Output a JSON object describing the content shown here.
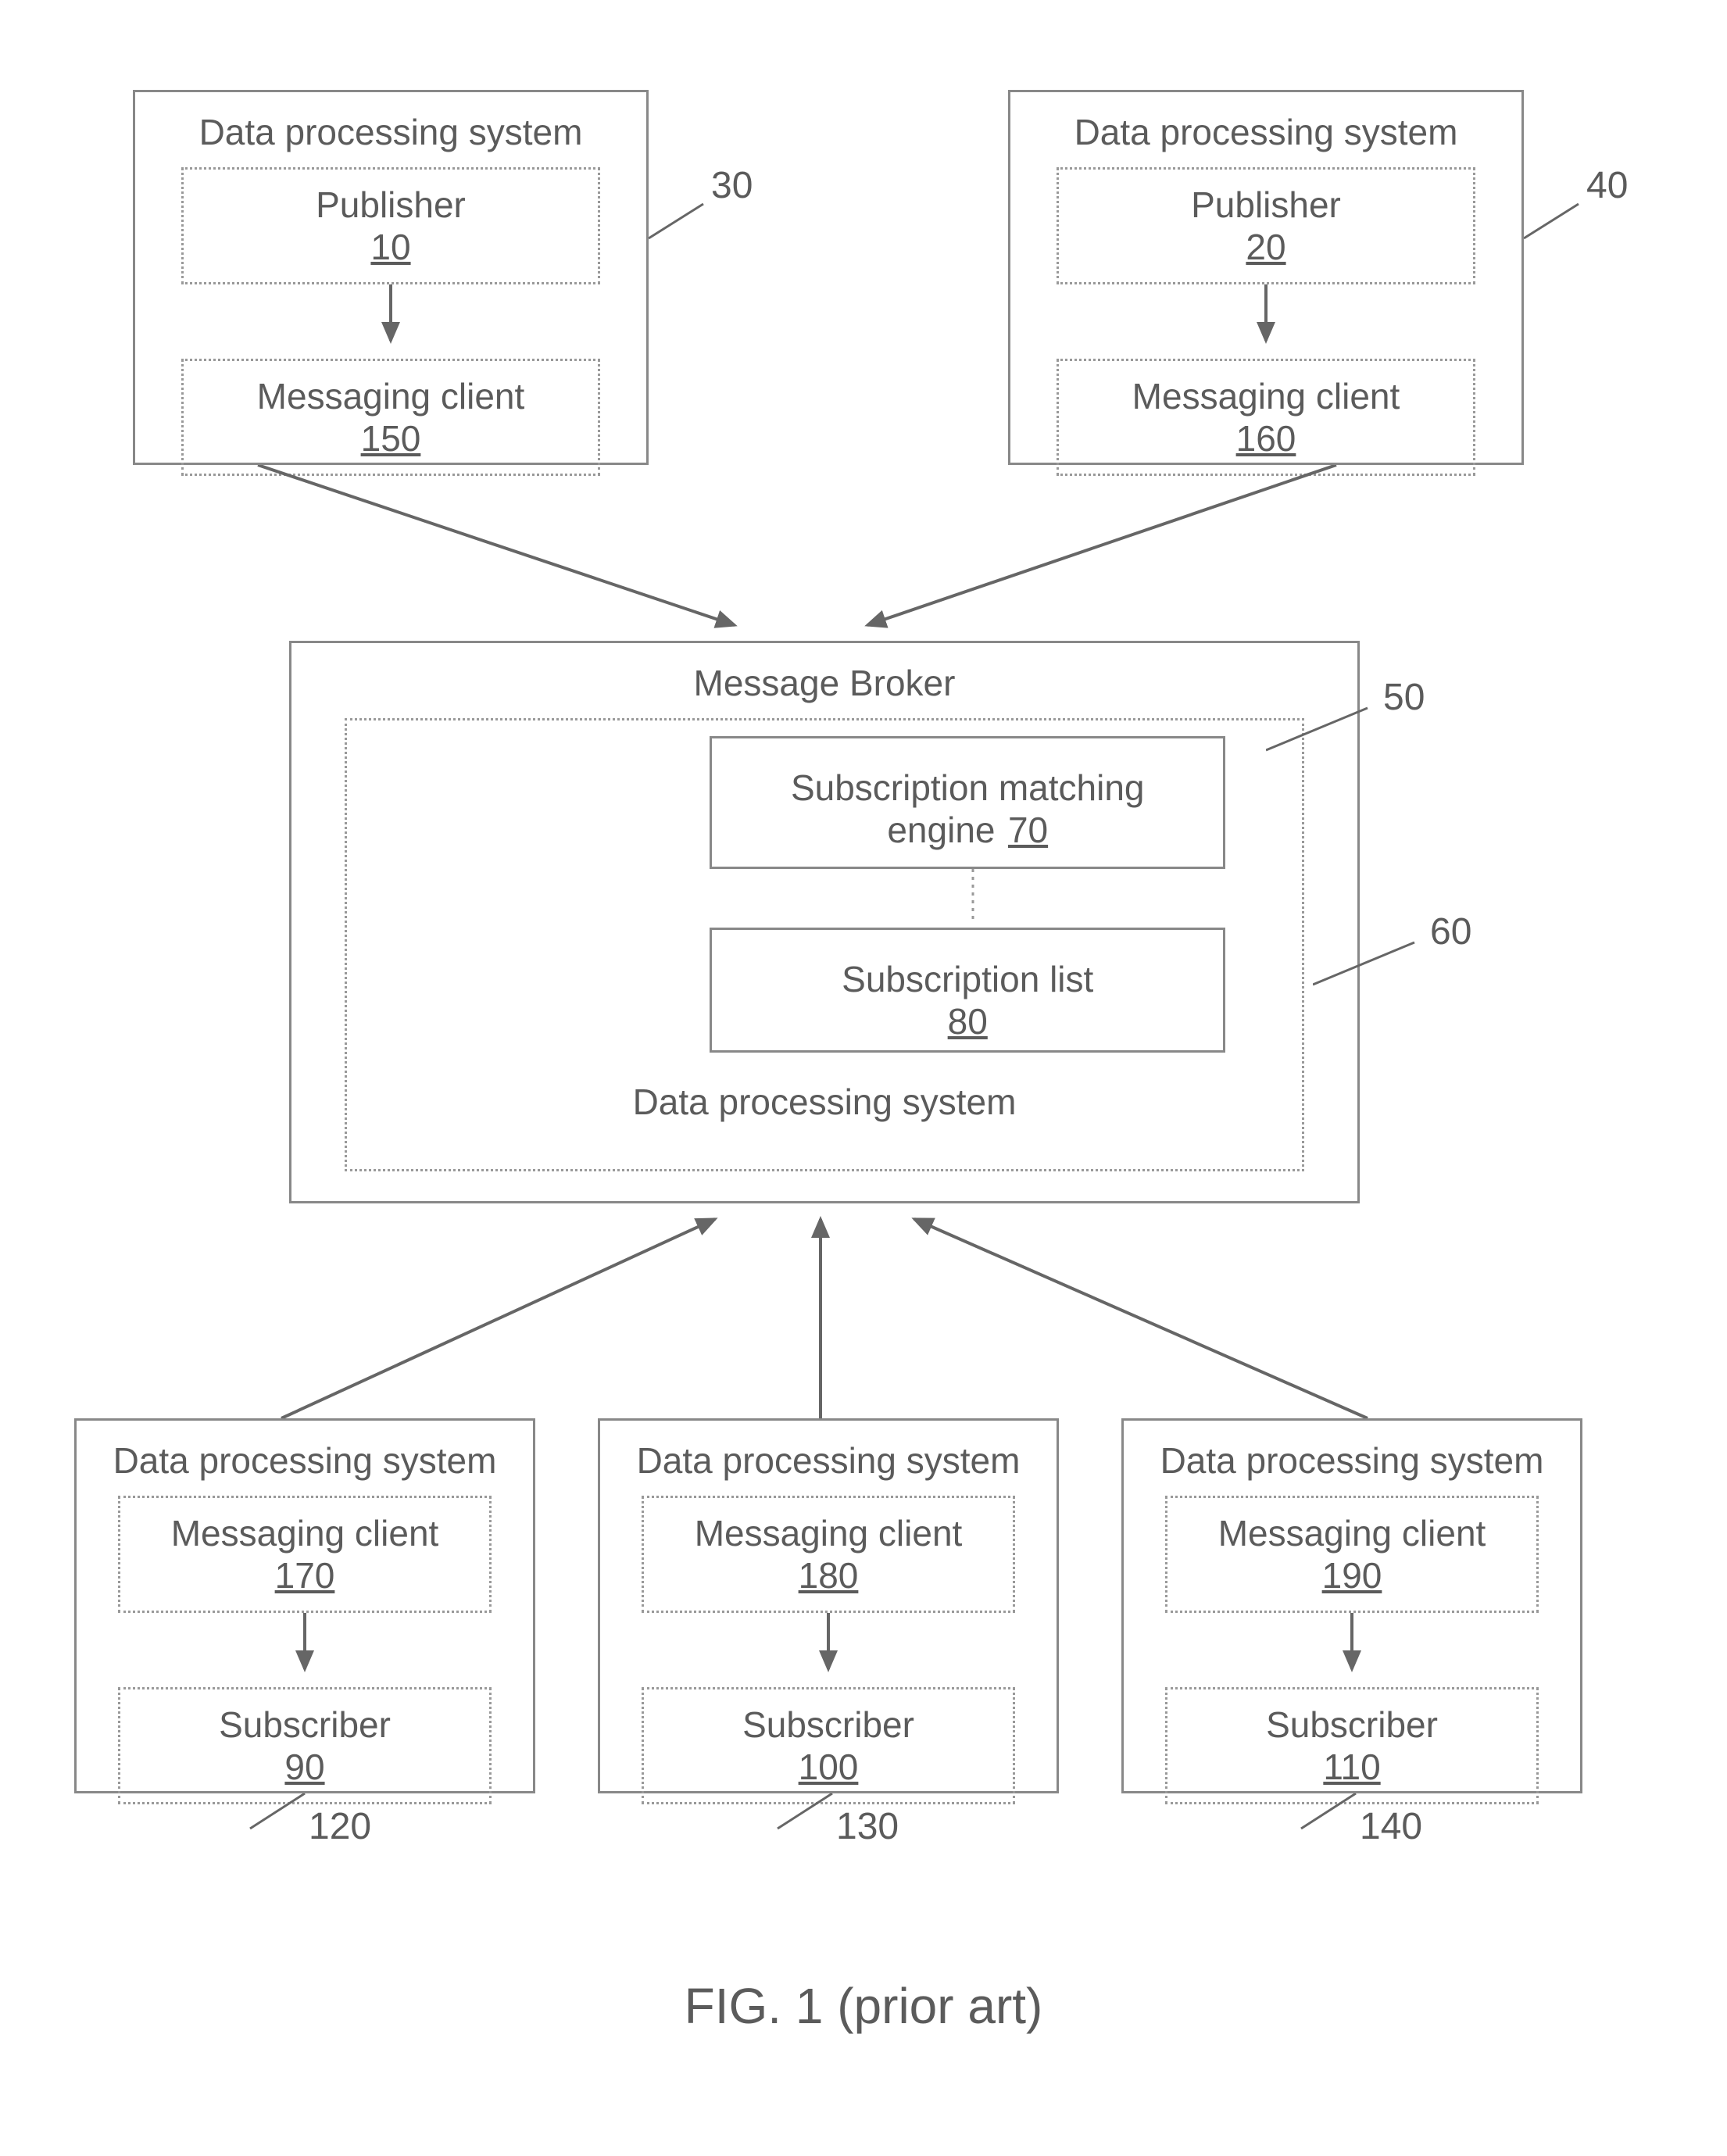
{
  "caption": "FIG. 1 (prior art)",
  "publisher1": {
    "outer": "Data processing system",
    "pubTitle": "Publisher",
    "pubNum": "10",
    "mcTitle": "Messaging client",
    "mcNum": "150",
    "ref": "30"
  },
  "publisher2": {
    "outer": "Data processing system",
    "pubTitle": "Publisher",
    "pubNum": "20",
    "mcTitle": "Messaging client",
    "mcNum": "160",
    "ref": "40"
  },
  "broker": {
    "title": "Message Broker",
    "dpsTitle": "Data processing system",
    "smeTitle": "Subscription matching",
    "smeLine2": "engine",
    "smeNum": "70",
    "slTitle": "Subscription list",
    "slNum": "80",
    "ref50": "50",
    "ref60": "60"
  },
  "sub1": {
    "outer": "Data processing system",
    "mcTitle": "Messaging client",
    "mcNum": "170",
    "subTitle": "Subscriber",
    "subNum": "90",
    "ref": "120"
  },
  "sub2": {
    "outer": "Data processing system",
    "mcTitle": "Messaging client",
    "mcNum": "180",
    "subTitle": "Subscriber",
    "subNum": "100",
    "ref": "130"
  },
  "sub3": {
    "outer": "Data processing system",
    "mcTitle": "Messaging client",
    "mcNum": "190",
    "subTitle": "Subscriber",
    "subNum": "110",
    "ref": "140"
  }
}
